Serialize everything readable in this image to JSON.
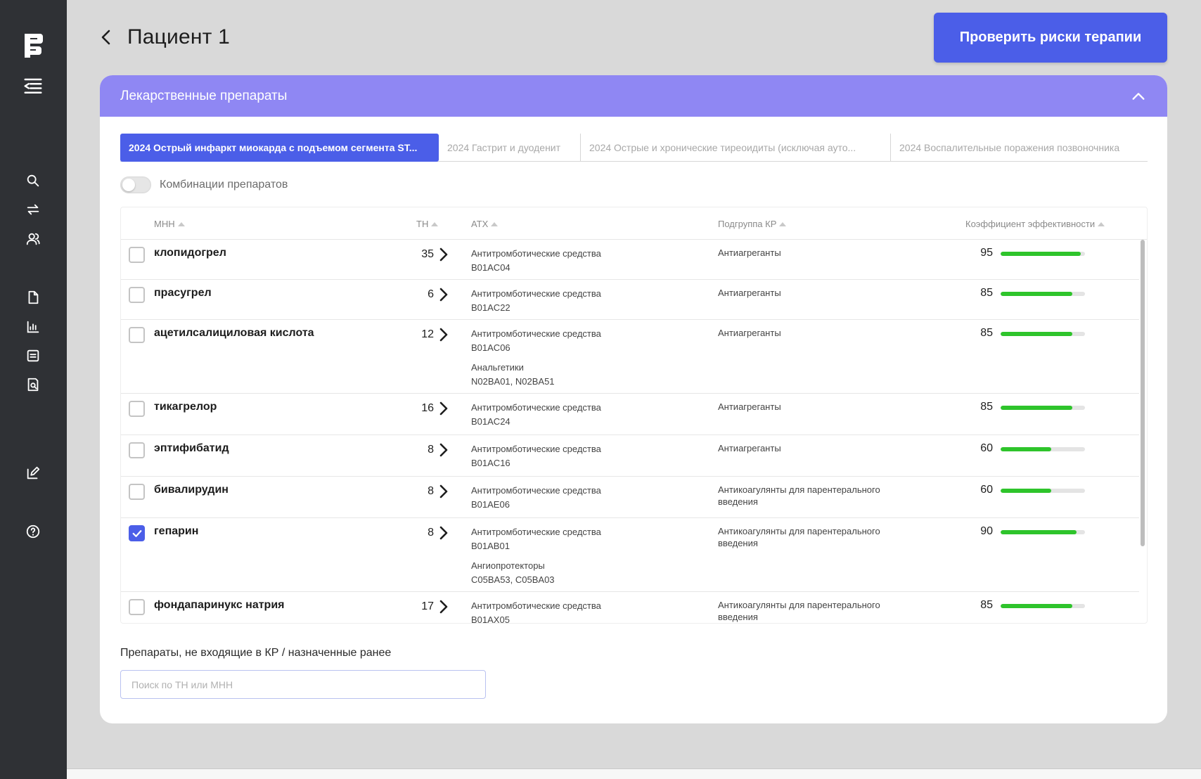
{
  "sidebar": {
    "logo": "brand-logo",
    "items": [
      {
        "name": "menu-collapse-icon"
      },
      {
        "name": "search-icon"
      },
      {
        "name": "swap-icon"
      },
      {
        "name": "users-icon"
      },
      {
        "name": "document-icon"
      },
      {
        "name": "chart-icon"
      },
      {
        "name": "form-icon"
      },
      {
        "name": "report-icon"
      },
      {
        "name": "edit-icon"
      },
      {
        "name": "help-icon"
      }
    ]
  },
  "header": {
    "title": "Пациент 1",
    "check_button": "Проверить риски терапии"
  },
  "panel": {
    "title": "Лекарственные препараты",
    "tabs": [
      "2024 Острый инфаркт миокарда с подъемом сегмента ST...",
      "2024 Гастрит и дуоденит",
      "2024 Острые и хронические тиреоидиты (исключая ауто...",
      "2024 Воспалительные поражения позвоночника"
    ],
    "active_tab": 0,
    "toggle_label": "Комбинации препаратов",
    "toggle_on": false
  },
  "table": {
    "columns": {
      "mnn": "МНН",
      "tn": "ТН",
      "atx": "АТХ",
      "subgroup": "Подгруппа КР",
      "efficiency": "Коэффициент эффективности"
    },
    "rows": [
      {
        "mnn": "клопидогрел",
        "tn": "35",
        "atx": [
          {
            "group": "Антитромботические средства",
            "code": "B01AC04"
          }
        ],
        "subgroup": "Антиагреганты",
        "eff": 95,
        "checked": false
      },
      {
        "mnn": "прасугрел",
        "tn": "6",
        "atx": [
          {
            "group": "Антитромботические средства",
            "code": "B01AC22"
          }
        ],
        "subgroup": "Антиагреганты",
        "eff": 85,
        "checked": false
      },
      {
        "mnn": "ацетилсалициловая кислота",
        "tn": "12",
        "atx": [
          {
            "group": "Антитромботические средства",
            "code": "B01AC06"
          },
          {
            "group": "Анальгетики",
            "code": "N02BA01, N02BA51"
          }
        ],
        "subgroup": "Антиагреганты",
        "eff": 85,
        "checked": false
      },
      {
        "mnn": "тикагрелор",
        "tn": "16",
        "atx": [
          {
            "group": "Антитромботические средства",
            "code": "B01AC24"
          }
        ],
        "subgroup": "Антиагреганты",
        "eff": 85,
        "checked": false
      },
      {
        "mnn": "эптифибатид",
        "tn": "8",
        "atx": [
          {
            "group": "Антитромботические средства",
            "code": "B01AC16"
          }
        ],
        "subgroup": "Антиагреганты",
        "eff": 60,
        "checked": false
      },
      {
        "mnn": "бивалирудин",
        "tn": "8",
        "atx": [
          {
            "group": "Антитромботические средства",
            "code": "B01AE06"
          }
        ],
        "subgroup": "Антикоагулянты для парентерального введения",
        "eff": 60,
        "checked": false
      },
      {
        "mnn": "гепарин",
        "tn": "8",
        "atx": [
          {
            "group": "Антитромботические средства",
            "code": "B01AB01"
          },
          {
            "group": "Ангиопротекторы",
            "code": "C05BA53, C05BA03"
          }
        ],
        "subgroup": "Антикоагулянты для парентерального введения",
        "eff": 90,
        "checked": true
      },
      {
        "mnn": "фондапаринукс натрия",
        "tn": "17",
        "atx": [
          {
            "group": "Антитромботические средства",
            "code": "B01AX05"
          }
        ],
        "subgroup": "Антикоагулянты для парентерального введения",
        "eff": 85,
        "checked": false
      }
    ]
  },
  "extra": {
    "label": "Препараты, не входящие в КР / назначенные ранее",
    "search_placeholder": "Поиск по ТН или МНН",
    "search_value": ""
  },
  "colors": {
    "accent": "#4b5ee8",
    "panel_header": "#8f87f3",
    "sidebar": "#2f3135",
    "efficiency_bar": "#2ec42b"
  }
}
